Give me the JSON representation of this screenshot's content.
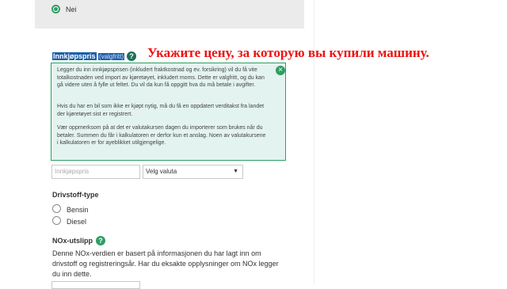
{
  "top_option": {
    "label": "Nei"
  },
  "price": {
    "title": "Innkjøpspris",
    "optional": "(valgfritt)",
    "help": "?",
    "tooltip": {
      "p1": "Legger du inn innkjøpsprisen (inkludert fraktkostnad og ev. forsikring) vil du få vite totalkostnaden ved import av kjøretøyet, inkludert moms. Dette er valgfritt, og du kan gå videre uten å fylle ut feltet. Du vil da kun få oppgitt hva du må betale i avgifter.",
      "p2": "Hvis du har en bil som ikke er kjøpt nytig, må du få en oppdatert verditakst fra landet der kjøretøyet sist er registrert.",
      "p3": "Vær oppmerksom på at det er valutakursen dagen du importerer som brukes når du betaler. Summen du får i kalkulatoren er derfor kun et anslag. Noen av valutakursene i kalkulatoren er for ayeblikket utilgjengelige.",
      "close": "×"
    },
    "input_placeholder": "Innkjøpspris",
    "currency_select": "Velg valuta"
  },
  "fuel": {
    "title": "Drivstoff-type",
    "options": [
      "Bensin",
      "Diesel"
    ]
  },
  "nox": {
    "title": "NOx-utslipp",
    "help": "?",
    "desc1": "Denne NOx-verdien er basert på informasjonen du har lagt inn om",
    "desc2": "drivstoff og registreringsår. Har du eksakte opplysninger om NOx legger",
    "desc3": "du inn dette."
  },
  "annotation": "Укажите цену, за которую вы купили машину."
}
